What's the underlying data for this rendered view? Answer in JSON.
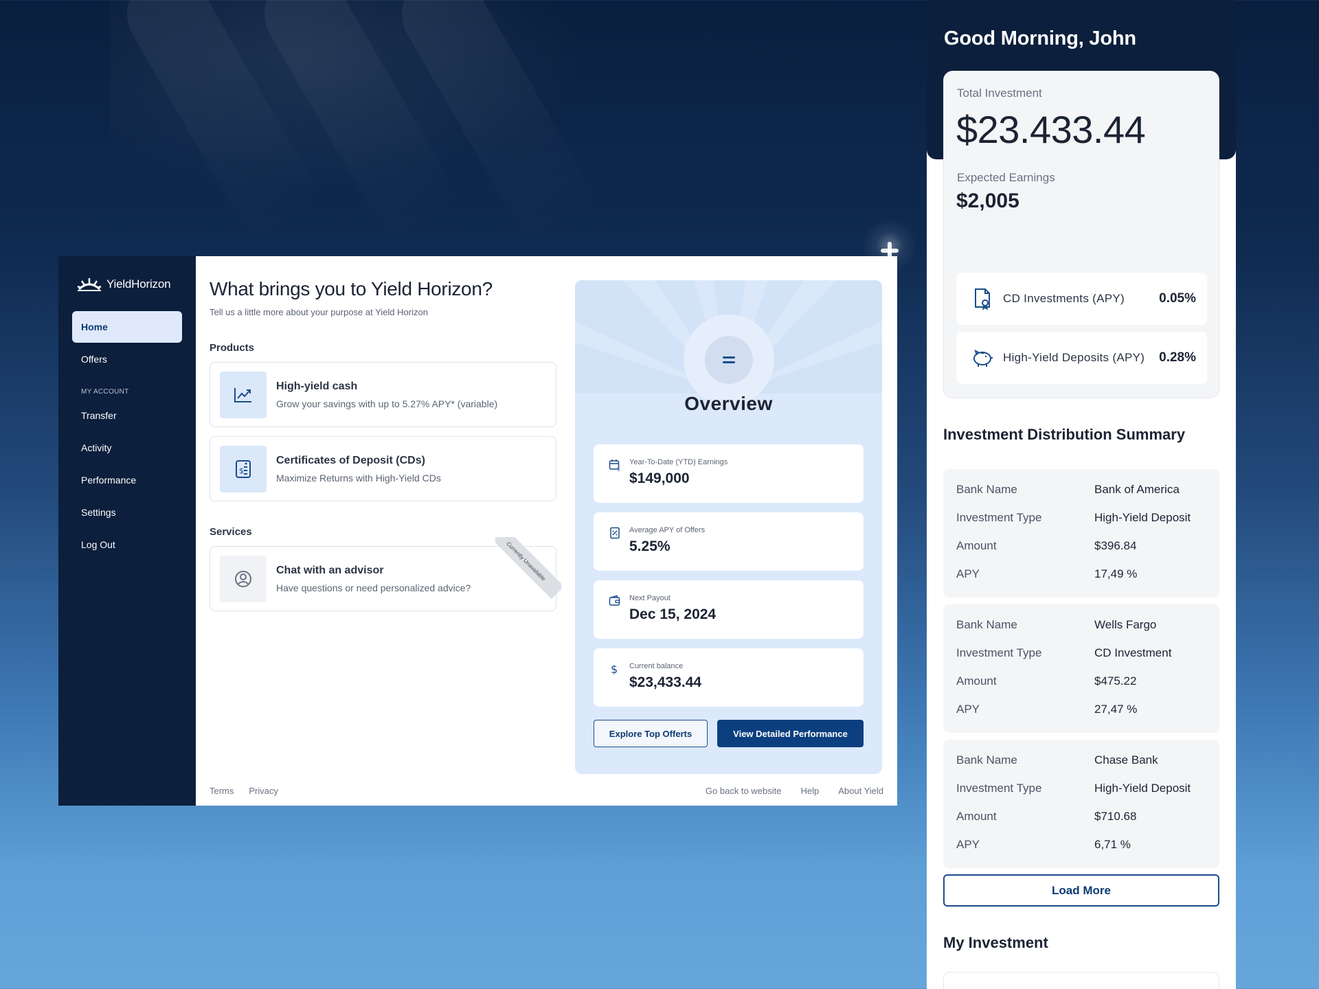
{
  "brand": {
    "name": "YieldHorizon"
  },
  "sidebar": {
    "items": [
      {
        "label": "Home",
        "active": true
      },
      {
        "label": "Offers"
      }
    ],
    "section_label": "MY ACCOUNT",
    "account_items": [
      {
        "label": "Transfer"
      },
      {
        "label": "Activity"
      },
      {
        "label": "Performance"
      },
      {
        "label": "Settings"
      },
      {
        "label": "Log Out"
      }
    ]
  },
  "main": {
    "title": "What brings you to Yield Horizon?",
    "subtitle": "Tell us a little more about your purpose at Yield Horizon",
    "products_label": "Products",
    "products": [
      {
        "title": "High-yield cash",
        "desc": "Grow your savings with up to 5.27% APY* (variable)",
        "icon": "chart-line-icon"
      },
      {
        "title": "Certificates of Deposit (CDs)",
        "desc": "Maximize Returns with High-Yield CDs",
        "icon": "document-dollar-icon"
      }
    ],
    "services_label": "Services",
    "services": [
      {
        "title": "Chat with an advisor",
        "desc": "Have questions or need personalized advice?",
        "ribbon": "Currently Unavailable",
        "icon": "user-circle-icon"
      }
    ]
  },
  "overview": {
    "title": "Overview",
    "stats": [
      {
        "label": "Year-To-Date (YTD) Earnings",
        "value": "$149,000",
        "icon": "calendar-dollar-icon"
      },
      {
        "label": "Average APY of Offers",
        "value": "5.25%",
        "icon": "percent-doc-icon"
      },
      {
        "label": "Next Payout",
        "value": "Dec 15, 2024",
        "icon": "wallet-icon"
      },
      {
        "label": "Current balance",
        "value": "$23,433.44",
        "icon": "dollar-icon"
      }
    ],
    "buttons": {
      "explore": "Explore Top Offerts",
      "performance": "View Detailed Performance"
    }
  },
  "footer": {
    "left": [
      "Terms",
      "Privacy"
    ],
    "right": [
      "Go back to website",
      "Help",
      "About Yield"
    ]
  },
  "right_panel": {
    "greeting": "Good Morning, John",
    "total_label": "Total Investment",
    "total_value": "$23.433.44",
    "earnings_label": "Expected Earnings",
    "earnings_value": "$2,005",
    "apy_rows": [
      {
        "name": "CD Investments (APY)",
        "value": "0.05%",
        "icon": "certificate-icon"
      },
      {
        "name": "High-Yield Deposits (APY)",
        "value": "0.28%",
        "icon": "piggy-bank-icon"
      }
    ],
    "distribution_title": "Investment Distribution Summary",
    "keys": {
      "bank": "Bank Name",
      "type": "Investment Type",
      "amount": "Amount",
      "apy": "APY"
    },
    "distribution": [
      {
        "bank": "Bank of America",
        "type": "High-Yield Deposit",
        "amount": "$396.84",
        "apy": "17,49 %"
      },
      {
        "bank": "Wells Fargo",
        "type": "CD Investment",
        "amount": "$475.22",
        "apy": "27,47 %"
      },
      {
        "bank": "Chase Bank",
        "type": "High-Yield Deposit",
        "amount": "$710.68",
        "apy": "6,71 %"
      }
    ],
    "load_more": "Load More",
    "my_investment_title": "My Investment"
  },
  "colors": {
    "sidebar_bg": "#0c1f3c",
    "accent": "#0c3f7f",
    "overview_bg": "#dce9fb"
  }
}
